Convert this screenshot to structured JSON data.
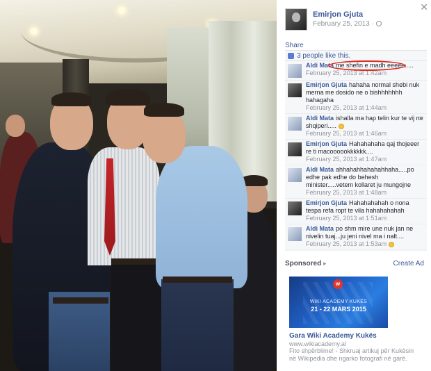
{
  "post": {
    "author": "Emirjon Gjuta",
    "date": "February 25, 2013 ·",
    "share_label": "Share",
    "likes_text": "3 people like this."
  },
  "comments": [
    {
      "author": "Aldi Mata",
      "text": "me shefin e madh eeeee.....",
      "date": "February 25, 2013 at 1:42am"
    },
    {
      "author": "Emirjon Gjuta",
      "text": "hahaha normal shebi nuk merna me dosido ne o bishhhhhhh hahagaha",
      "date": "February 25, 2013 at 1:44am"
    },
    {
      "author": "Aldi Mata",
      "text": "ishalla ma hap telin kur te vij ne shqiperi.....",
      "date": "February 25, 2013 at 1:46am"
    },
    {
      "author": "Emirjon Gjuta",
      "text": "Hahahahaha qaj thojeeer re ti macoooookkkkkk....",
      "date": "February 25, 2013 at 1:47am"
    },
    {
      "author": "Aldi Mata",
      "text": "ahhahahhahahahhaha.....po edhe pak edhe do behesh minister.....vetem kollaret ju mungojne",
      "date": "February 25, 2013 at 1:48am"
    },
    {
      "author": "Emirjon Gjuta",
      "text": "Hahahahahah o nona tespa refa ropt te vila hahahahahah",
      "date": "February 25, 2013 at 1:51am"
    },
    {
      "author": "Aldi Mata",
      "text": "po shm mire une nuk jan ne nivelin tuaj...ju jeni nivel ma i nalt....",
      "date": "February 25, 2013 at 1:53am"
    }
  ],
  "sponsored": {
    "label": "Sponsored",
    "create_ad": "Create Ad",
    "ad_line1": "WIKI ACADEMY KUKËS",
    "ad_line2": "21 - 22 MARS 2015",
    "ad_badge": "w",
    "title": "Gara Wiki Academy Kukës",
    "url": "www.wikiacademy.al",
    "description": "Fito shpërblime! - Shkruaj artikuj për Kukësin në Wikipedia dhe ngarko fotografi në garë."
  },
  "icons": {
    "close": "close-icon",
    "like": "thumbs-up-icon",
    "privacy": "globe-icon",
    "remove": "remove-comment-icon",
    "emoji": "smile-icon"
  },
  "colors": {
    "link": "#3b5998",
    "meta": "#90949c",
    "annotation": "#e0281f"
  }
}
